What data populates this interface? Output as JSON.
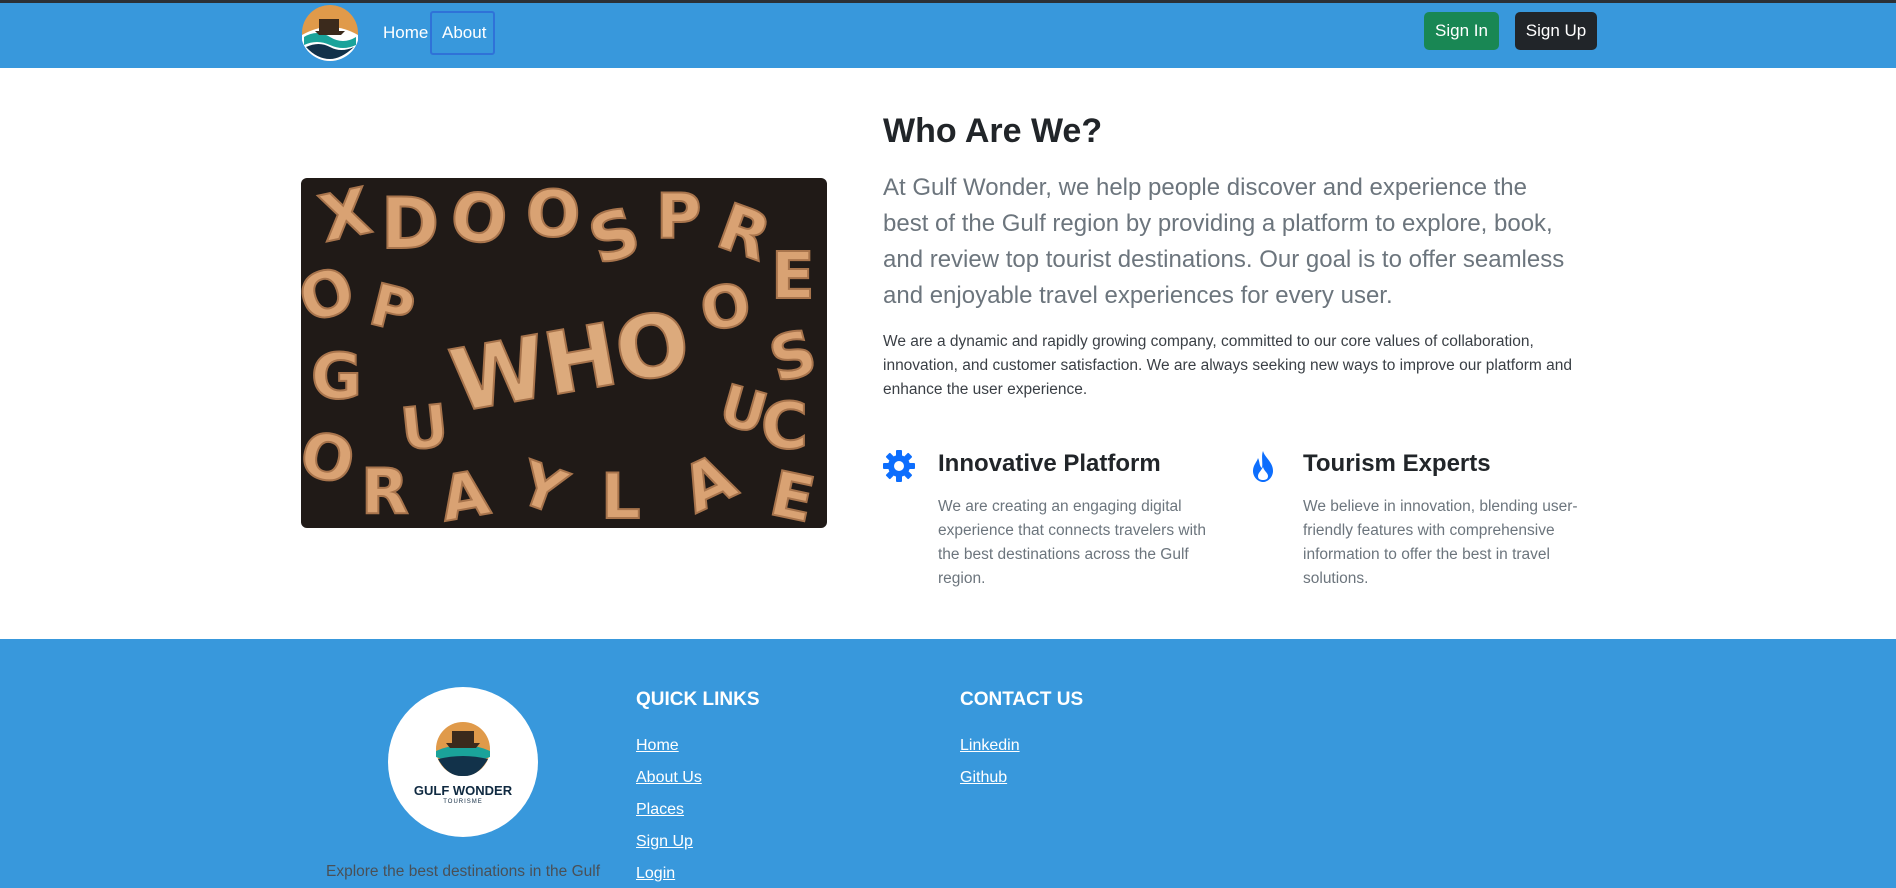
{
  "navbar": {
    "logo_icon": "gulf-wonder-logo-icon",
    "home_label": "Home",
    "about_label": "About",
    "signin_label": "Sign In",
    "signup_label": "Sign Up",
    "colors": {
      "background": "#3898dc",
      "signin": "#198754",
      "signup": "#212529"
    }
  },
  "main": {
    "image_text": "WHO",
    "title": "Who Are We?",
    "lead": "At Gulf Wonder, we help people discover and experience the best of the Gulf region by providing a platform to explore, book, and review top tourist destinations. Our goal is to offer seamless and enjoyable travel experiences for every user.",
    "body": "We are a dynamic and rapidly growing company, committed to our core values of collaboration, innovation, and customer satisfaction. We are always seeking new ways to improve our platform and enhance the user experience.",
    "features": [
      {
        "icon": "gear-icon",
        "title": "Innovative Platform",
        "text": "We are creating an engaging digital experience that connects travelers with the best destinations across the Gulf region."
      },
      {
        "icon": "fire-icon",
        "title": "Tourism Experts",
        "text": "We believe in innovation, blending user-friendly features with comprehensive information to offer the best in travel solutions."
      }
    ],
    "colors": {
      "icon": "#0d6efd"
    }
  },
  "footer": {
    "brand": "GULF WONDER",
    "brand_sub": "TOURISME",
    "tagline": "Explore the best destinations in the Gulf",
    "quick_links_heading": "QUICK LINKS",
    "quick_links": [
      "Home",
      "About Us",
      "Places",
      "Sign Up",
      "Login"
    ],
    "contact_heading": "CONTACT US",
    "contact_links": [
      "Linkedin",
      "Github"
    ]
  }
}
